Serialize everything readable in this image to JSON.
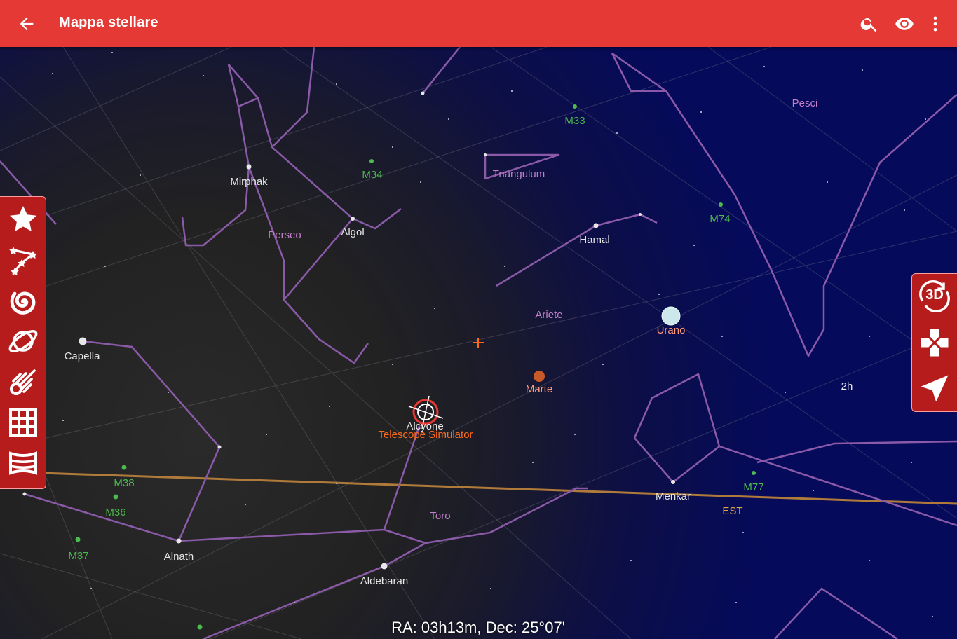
{
  "appbar": {
    "title": "Mappa stellare",
    "icons": [
      "arrow-back-icon",
      "search-icon",
      "eye-icon",
      "more-vert-icon"
    ],
    "color": "#e53935"
  },
  "sky": {
    "stars": [
      "Mirphak",
      "Algol",
      "Capella",
      "Hamal",
      "Alcyone",
      "Menkar",
      "Alnath",
      "Aldebaran"
    ],
    "constellations": [
      "Perseo",
      "Triangulum",
      "Ariete",
      "Toro",
      "Pesci"
    ],
    "deep_sky": [
      "M33",
      "M34",
      "M74",
      "M38",
      "M36",
      "M37",
      "M77"
    ],
    "planets": [
      "Urano",
      "Marte"
    ],
    "telescope": "Telescope Simulator",
    "direction": "EST",
    "ra_marker": "2h",
    "coordinates": "RA: 03h13m, Dec: 25°07'"
  },
  "left_toolbar": {
    "icons": [
      "star-icon",
      "constellation-icon",
      "galaxy-icon",
      "planet-icon",
      "comet-icon",
      "grid-icon",
      "horizon-icon"
    ]
  },
  "right_toolbar": {
    "label_3d": "3D",
    "icons": [
      "rotate-3d-icon",
      "dpad-icon",
      "navigation-icon"
    ]
  }
}
